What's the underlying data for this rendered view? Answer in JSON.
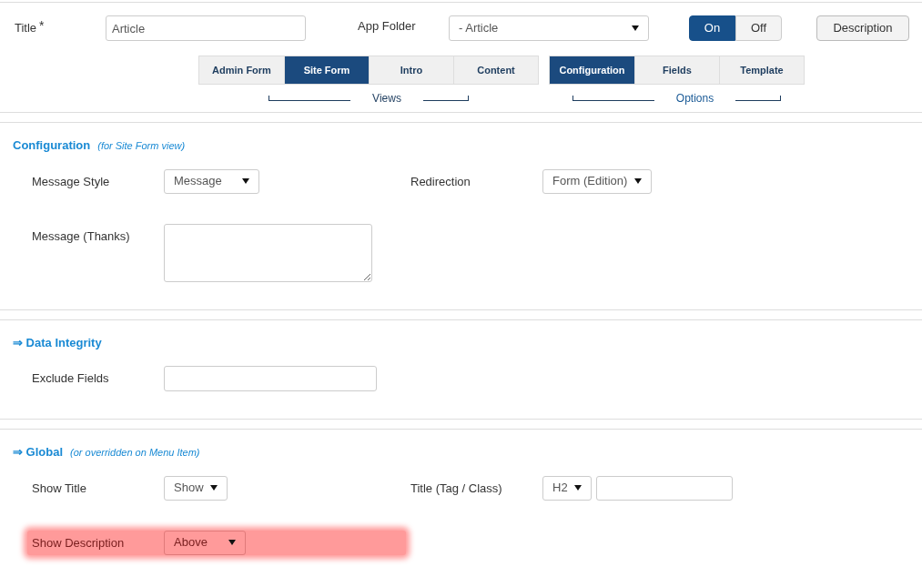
{
  "header": {
    "title_label": "Title",
    "required_mark": "*",
    "title_value": "Article",
    "folder_label": "App Folder",
    "folder_value": "- Article",
    "toggle": [
      {
        "label": "On",
        "selected": true
      },
      {
        "label": "Off",
        "selected": false
      }
    ],
    "description_button": "Description",
    "tab_groups": [
      {
        "caption": "Views",
        "tabs": [
          {
            "label": "Admin Form",
            "selected": false
          },
          {
            "label": "Site Form",
            "selected": true
          },
          {
            "label": "Intro",
            "selected": false
          },
          {
            "label": "Content",
            "selected": false
          }
        ]
      },
      {
        "caption": "Options",
        "tabs": [
          {
            "label": "Configuration",
            "selected": true
          },
          {
            "label": "Fields",
            "selected": false
          },
          {
            "label": "Template",
            "selected": false
          }
        ]
      }
    ]
  },
  "sections": [
    {
      "title": "Configuration",
      "note": "(for Site Form view)",
      "rows": [
        [
          {
            "label": "Message Style",
            "kind": "select",
            "value": "Message",
            "highlighted": false
          },
          {
            "label": "Redirection",
            "kind": "select",
            "value": "Form (Edition)",
            "highlighted": false
          }
        ],
        [
          {
            "label": "Message (Thanks)",
            "kind": "textarea",
            "highlighted": false
          }
        ]
      ]
    },
    {
      "arrow": "⇒",
      "title": "Data Integrity",
      "rows": [
        [
          {
            "label": "Exclude Fields",
            "kind": "text",
            "highlighted": false
          }
        ]
      ]
    },
    {
      "arrow": "⇒",
      "title": "Global",
      "note": "(or overridden on Menu Item)",
      "rows": [
        [
          {
            "label": "Show Title",
            "kind": "select",
            "value": "Show",
            "highlighted": false
          },
          {
            "label": "Title (Tag / Class)",
            "kind": "select-text",
            "value": "H2",
            "highlighted": false
          }
        ],
        [
          {
            "label": "Show Description",
            "kind": "select",
            "value": "Above",
            "highlighted": true
          }
        ]
      ]
    }
  ]
}
